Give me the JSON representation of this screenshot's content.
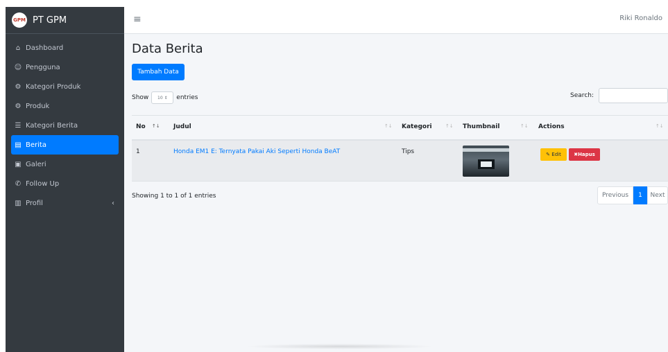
{
  "brand": {
    "logo_text": "GPM",
    "title": "PT GPM"
  },
  "sidebar": {
    "items": [
      {
        "label": "Dashboard",
        "icon": "home-icon"
      },
      {
        "label": "Pengguna",
        "icon": "users-icon"
      },
      {
        "label": "Kategori Produk",
        "icon": "motorcycle-icon"
      },
      {
        "label": "Produk",
        "icon": "motorcycle-icon"
      },
      {
        "label": "Kategori Berita",
        "icon": "list-icon"
      },
      {
        "label": "Berita",
        "icon": "newspaper-icon",
        "active": true
      },
      {
        "label": "Galeri",
        "icon": "image-icon"
      },
      {
        "label": "Follow Up",
        "icon": "phone-icon"
      },
      {
        "label": "Profil",
        "icon": "building-icon",
        "caret": "‹"
      }
    ]
  },
  "topbar": {
    "menu_icon": "≡",
    "user_name": "Riki Ronaldo"
  },
  "page": {
    "title": "Data Berita",
    "add_button": "Tambah Data"
  },
  "table_controls": {
    "show_label": "Show",
    "page_length": "10",
    "entries_label": "entries",
    "search_label": "Search:",
    "search_value": ""
  },
  "table": {
    "columns": [
      "No",
      "Judul",
      "Kategori",
      "Thumbnail",
      "Actions"
    ],
    "rows": [
      {
        "no": "1",
        "judul": "Honda EM1 E: Ternyata Pakai Aki Seperti Honda BeAT",
        "kategori": "Tips",
        "edit_label": "Edit",
        "delete_label": "Hapus"
      }
    ]
  },
  "footer": {
    "info": "Showing 1 to 1 of 1 entries",
    "pagination": {
      "previous": "Previous",
      "current": "1",
      "next": "Next"
    }
  },
  "colors": {
    "sidebar_bg": "#343a40",
    "primary": "#007bff",
    "warning": "#ffc107",
    "danger": "#dc3545",
    "content_bg": "#f4f6f9"
  }
}
